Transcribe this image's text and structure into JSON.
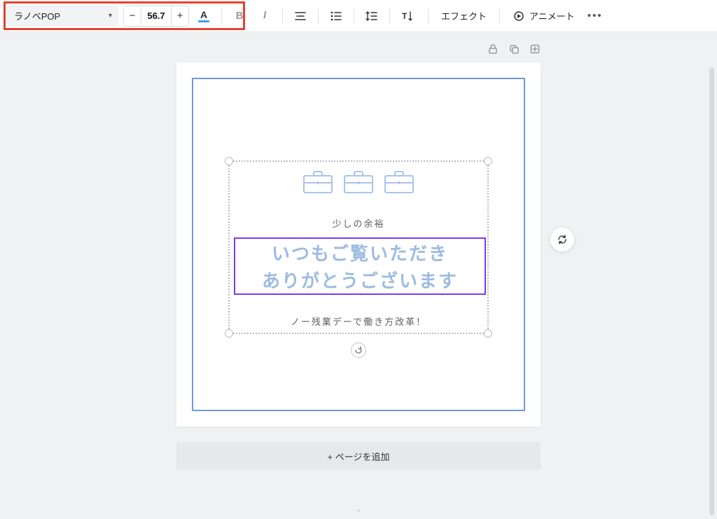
{
  "toolbar": {
    "font_name": "ラノベPOP",
    "font_size": "56.7",
    "decrease": "−",
    "increase": "+",
    "color_letter": "A",
    "bold": "B",
    "italic": "I",
    "effects_label": "エフェクト",
    "animate_label": "アニメート",
    "more": "•••",
    "accent_color": "#3aa1e8"
  },
  "page_tools": {
    "lock": "🔒",
    "copy": "⧉",
    "add": "＋"
  },
  "canvas": {
    "caption_top": "少しの余裕",
    "main_line_1": "いつもご覧いただき",
    "main_line_2": "ありがとうございます",
    "caption_bottom": "ノー残業デーで働き方改革！",
    "briefcase_color": "#a8c4ea"
  },
  "add_page_label": "+ ページを追加"
}
